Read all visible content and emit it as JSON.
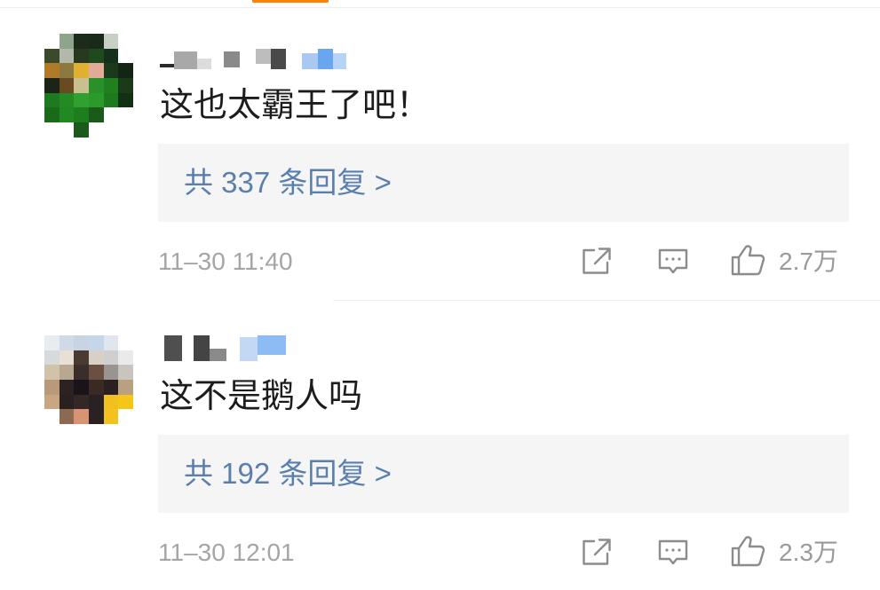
{
  "theme": {
    "accent": "#ff8200",
    "text": "#1c1c1c",
    "link": "#5a7fad",
    "meta": "#a5a5a5",
    "reply_bg": "#f5f5f5",
    "icon": "#8c8c8c",
    "line": "#eeeeee"
  },
  "action_icons": {
    "share": "share-icon",
    "comment": "comment-icon",
    "like": "like-icon"
  },
  "comments": [
    {
      "avatar_pixels": [
        [
          "#ffffff",
          "#8fa48c",
          "#1c2b1c",
          "#1a2a1a",
          "#c8cfc4",
          "#ffffff"
        ],
        [
          "#3b4a2a",
          "#b3b9aa",
          "#29391f",
          "#1e4a1e",
          "#15301a",
          "#ffffff"
        ],
        [
          "#b07a28",
          "#8a7a40",
          "#e0b030",
          "#e2aa98",
          "#1a3a1a",
          "#152515"
        ],
        [
          "#1a2418",
          "#6a4a20",
          "#c8c090",
          "#2a902a",
          "#208020",
          "#1a3a18"
        ],
        [
          "#1e7a1e",
          "#248a24",
          "#30a030",
          "#2a9a2a",
          "#1e7a1e",
          "#123012"
        ],
        [
          "#1a6a1a",
          "#228822",
          "#1e7e1e",
          "#1a5a1a",
          "#ffffff",
          "#ffffff"
        ],
        [
          "#ffffff",
          "#ffffff",
          "#1a5a1a",
          "#ffffff",
          "#ffffff",
          "#ffffff"
        ]
      ],
      "text": "这也太霸王了吧！",
      "replies_label": "共 337 条回复 >",
      "timestamp": "11–30 11:40",
      "likes": "2.7万"
    },
    {
      "avatar_pixels": [
        [
          "#e8ecf0",
          "#d0dae6",
          "#c8d4e2",
          "#c4d6ea",
          "#dfe6ee",
          "#ffffff"
        ],
        [
          "#d6dadd",
          "#e6e0d6",
          "#4a3a32",
          "#d8d0c6",
          "#cfcfd0",
          "#eaeaea"
        ],
        [
          "#d2c2aa",
          "#b8a890",
          "#3a2e2c",
          "#6a5040",
          "#9a9490",
          "#c8c4be"
        ],
        [
          "#b89a7a",
          "#2c2222",
          "#1a1418",
          "#3a2a24",
          "#2a2020",
          "#b8a080"
        ],
        [
          "#c8a682",
          "#2a2020",
          "#342826",
          "#2a2222",
          "#f0c020",
          "#f5c518"
        ],
        [
          "#ffffff",
          "#8c6a52",
          "#d89274",
          "#2a2222",
          "#f2c21e",
          "#ffffff"
        ]
      ],
      "text": "这不是鹅人吗",
      "replies_label": "共 192 条回复 >",
      "timestamp": "11–30 12:01",
      "likes": "2.3万"
    }
  ]
}
